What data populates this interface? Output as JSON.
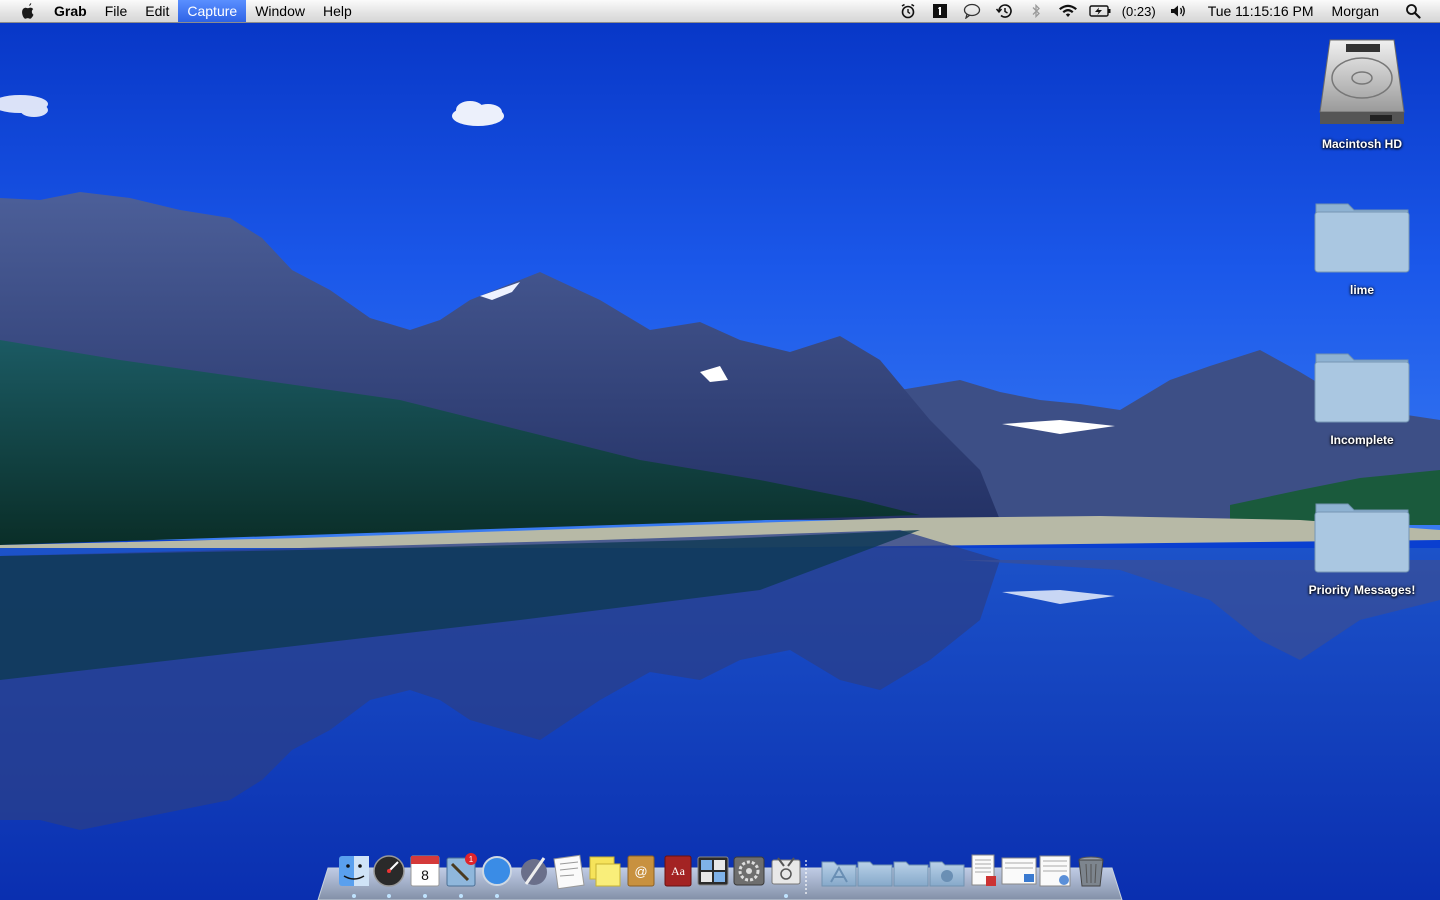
{
  "menubar": {
    "app_name": "Grab",
    "menus": [
      "File",
      "Edit",
      "Capture",
      "Window",
      "Help"
    ],
    "active_menu": "Capture",
    "battery_time": "(0:23)",
    "clock": "Tue 11:15:16 PM",
    "user": "Morgan",
    "status_icons": [
      "alarm-clock-icon",
      "one-password-icon",
      "chat-bubble-icon",
      "time-machine-icon",
      "bluetooth-icon",
      "wifi-icon",
      "battery-icon",
      "volume-icon",
      "spotlight-search-icon"
    ]
  },
  "desktop_icons": [
    {
      "label": "Macintosh HD",
      "icon": "hard-drive-icon"
    },
    {
      "label": "lime",
      "icon": "folder-icon"
    },
    {
      "label": "Incomplete",
      "icon": "folder-icon"
    },
    {
      "label": "Priority Messages!",
      "icon": "folder-icon"
    }
  ],
  "dock": {
    "calendar_date": "8",
    "mail_badge": "1",
    "dictionary_glyph": "Aa",
    "apps": [
      "finder",
      "dashboard",
      "ical",
      "mail",
      "safari",
      "scripting",
      "textedit",
      "stickies",
      "address-book",
      "dictionary",
      "expose",
      "system-preferences",
      "grab"
    ],
    "stacks": [
      "applications",
      "documents",
      "downloads",
      "shared",
      "document-1",
      "document-2",
      "document-3"
    ],
    "trash": "trash"
  },
  "colors": {
    "sky_top": "#0a3fd0",
    "sky_horizon": "#2a6cf0",
    "menu_highlight": "#2e63e6",
    "folder_blue": "#a9c6e0"
  }
}
